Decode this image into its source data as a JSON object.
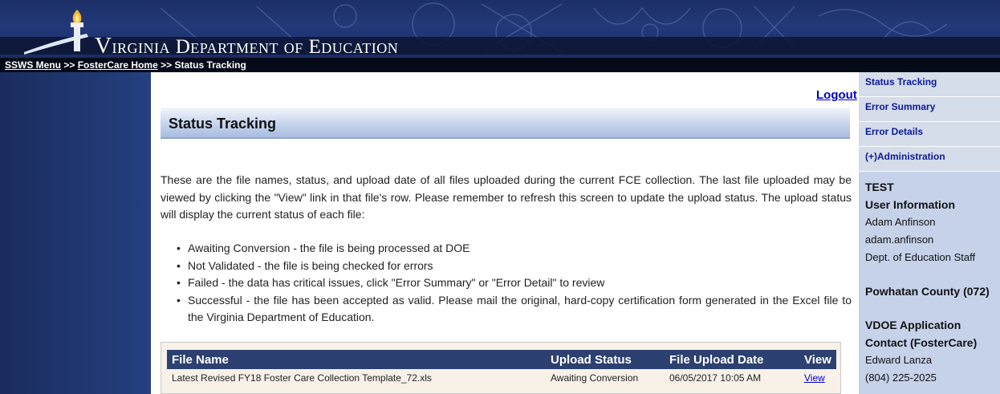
{
  "header": {
    "title": "Virginia Department of Education",
    "logo_icon": "torch-icon"
  },
  "breadcrumb": {
    "items": [
      "SSWS Menu",
      "FosterCare Home",
      "Status Tracking"
    ],
    "separator": ">>"
  },
  "main": {
    "logout_label": "Logout",
    "page_title": "Status Tracking",
    "intro": "These are the file names, status, and upload date of all files uploaded during the current FCE collection. The last file uploaded may be viewed by clicking the \"View\" link in that file's row. Please remember to refresh this screen to update the upload status. The upload status will display the current status of each file:",
    "bullets": [
      "Awaiting Conversion - the file is being processed at DOE",
      "Not Validated - the file is being checked for errors",
      "Failed - the data has critical issues, click \"Error Summary\" or \"Error Detail\" to review",
      "Successful - the file has been accepted as valid. Please mail the original, hard-copy certification form generated in the Excel file to the Virginia Department of Education."
    ],
    "table": {
      "columns": [
        "File Name",
        "Upload Status",
        "File Upload Date",
        "View"
      ],
      "rows": [
        {
          "file_name": "Latest Revised FY18 Foster Care Collection Template_72.xls",
          "status": "Awaiting Conversion",
          "date": "06/05/2017 10:05 AM",
          "view": "View"
        }
      ]
    }
  },
  "sidebar": {
    "nav": [
      "Status Tracking",
      "Error Summary",
      "Error Details",
      "(+)Administration"
    ],
    "user": {
      "env": "TEST",
      "heading": "User Information",
      "name": "Adam Anfinson",
      "username": "adam.anfinson",
      "role": "Dept. of Education Staff",
      "division": "Powhatan County (072)",
      "contact_heading_1": "VDOE Application",
      "contact_heading_2": "Contact (FosterCare)",
      "contact_name": "Edward Lanza",
      "contact_phone": "(804) 225-2025"
    }
  },
  "colors": {
    "banner": "#22397a",
    "title_bar": "#c6d4ec",
    "table_header": "#2c4170",
    "sidebar_right": "#c5d2ea",
    "link": "#0000cc"
  }
}
